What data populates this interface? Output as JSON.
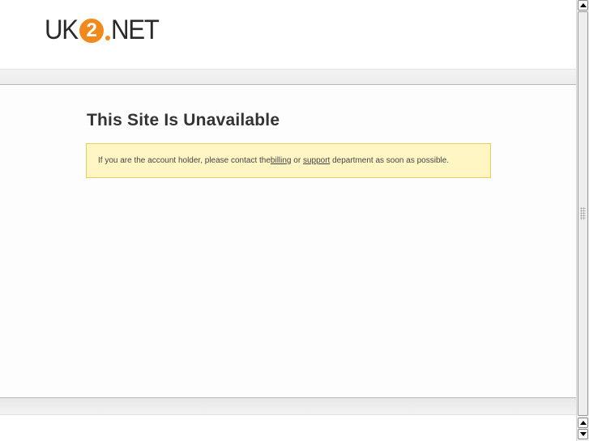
{
  "logo": {
    "prefix": "UK",
    "badge": "2",
    "suffix": "NET"
  },
  "page": {
    "title": "This Site Is Unavailable"
  },
  "notice": {
    "text_before": "If you are the account holder, please contact the ",
    "billing_link": "billing",
    "text_middle": " or ",
    "support_link": "support",
    "text_after": " department as soon as possible."
  },
  "colors": {
    "brand_orange": "#f08a1c",
    "notice_bg": "#fff6c4",
    "notice_border": "#e8cf5a",
    "title_text": "#333333"
  },
  "icons": {
    "scroll_up": "arrow-up-icon",
    "scroll_down": "arrow-down-icon",
    "thumb_grip": "grip-icon"
  }
}
